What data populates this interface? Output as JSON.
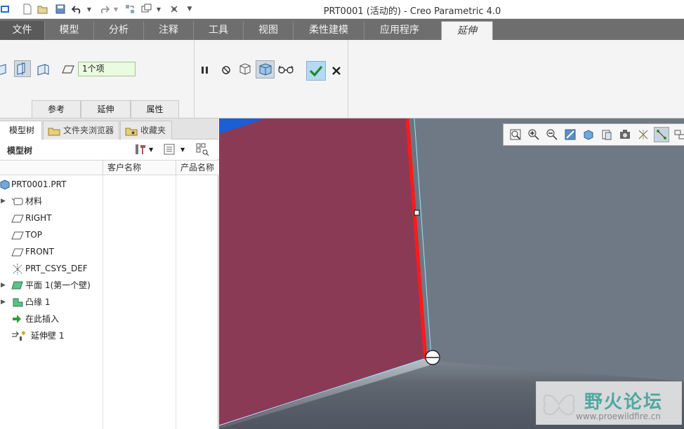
{
  "window": {
    "title": "PRT0001 (活动的) - Creo Parametric 4.0"
  },
  "ribbon_tabs": [
    {
      "label": "文件"
    },
    {
      "label": "模型"
    },
    {
      "label": "分析"
    },
    {
      "label": "注释"
    },
    {
      "label": "工具"
    },
    {
      "label": "视图"
    },
    {
      "label": "柔性建模"
    },
    {
      "label": "应用程序"
    },
    {
      "label": "延伸"
    }
  ],
  "ribbon": {
    "collector_value": "1个项",
    "subtabs": [
      {
        "label": "参考"
      },
      {
        "label": "延伸"
      },
      {
        "label": "属性"
      }
    ]
  },
  "navigator": {
    "tabs": [
      {
        "label": "模型树"
      },
      {
        "label": "文件夹浏览器"
      },
      {
        "label": "收藏夹"
      }
    ],
    "tree_title": "模型树",
    "columns": [
      {
        "label": "客户名称"
      },
      {
        "label": "产品名称"
      }
    ],
    "items": [
      {
        "label": "PRT0001.PRT"
      },
      {
        "label": "材料"
      },
      {
        "label": "RIGHT"
      },
      {
        "label": "TOP"
      },
      {
        "label": "FRONT"
      },
      {
        "label": "PRT_CSYS_DEF"
      },
      {
        "label": "平面 1(第一个壁)"
      },
      {
        "label": "凸缘 1"
      },
      {
        "label": "在此插入"
      },
      {
        "label": "延伸壁 1"
      }
    ]
  },
  "watermark": {
    "name": "野火论坛",
    "url": "www.proewildfire.cn"
  },
  "colors": {
    "tab_bar": "#6e6e6e",
    "model_face": "#8b3a55",
    "viewport_bg": "#6b7480",
    "edge_highlight": "#ff1a1a",
    "accent_blue": "#1a5fd6"
  }
}
